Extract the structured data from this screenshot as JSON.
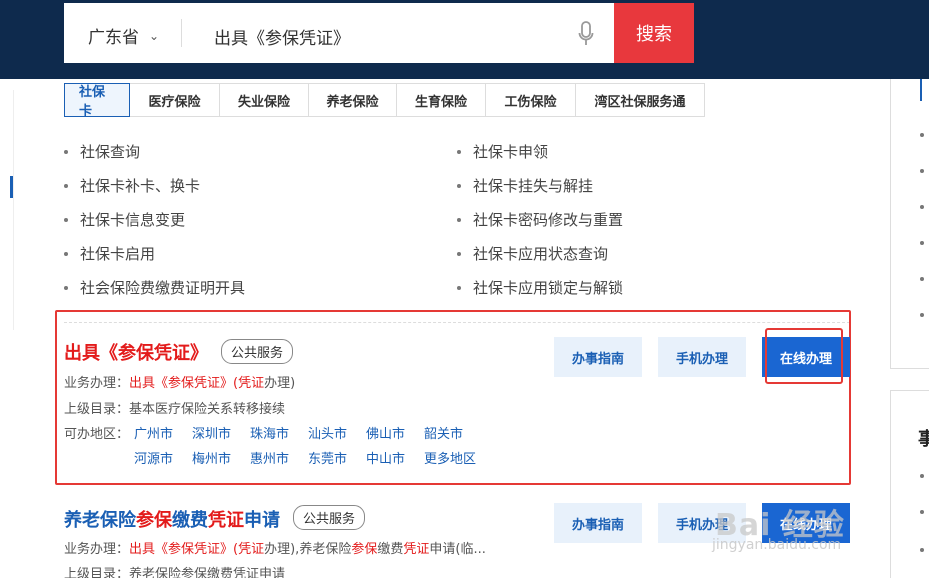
{
  "header": {
    "province": "广东省",
    "search_value": "出具《参保凭证》",
    "search_button": "搜索"
  },
  "tabs": [
    {
      "label": "社保卡",
      "active": true
    },
    {
      "label": "医疗保险"
    },
    {
      "label": "失业保险"
    },
    {
      "label": "养老保险"
    },
    {
      "label": "生育保险"
    },
    {
      "label": "工伤保险"
    },
    {
      "label": "湾区社保服务通"
    }
  ],
  "services": {
    "left": [
      "社保查询",
      "社保卡补卡、换卡",
      "社保卡信息变更",
      "社保卡启用",
      "社会保险费缴费证明开具"
    ],
    "right": [
      "社保卡申领",
      "社保卡挂失与解挂",
      "社保卡密码修改与重置",
      "社保卡应用状态查询",
      "社保卡应用锁定与解锁"
    ]
  },
  "results": [
    {
      "title_part1": "出具",
      "title_part2": "《参保凭证》",
      "tag": "公共服务",
      "business_label": "业务办理：",
      "business_part1": "出具《参保凭证》(",
      "business_part2": "凭证",
      "business_part3": "办理)",
      "catalog": "上级目录：基本医疗保险关系转移接续",
      "region_label": "可办地区：",
      "regions": [
        "广州市",
        "深圳市",
        "珠海市",
        "汕头市",
        "佛山市",
        "韶关市",
        "河源市",
        "梅州市",
        "惠州市",
        "东莞市",
        "中山市",
        "更多地区"
      ],
      "btn_guide": "办事指南",
      "btn_mobile": "手机办理",
      "btn_online": "在线办理"
    },
    {
      "title_a": "养老保险",
      "title_b": "参保",
      "title_c": "缴费",
      "title_d": "凭证",
      "title_e": "申请",
      "tag": "公共服务",
      "business_label": "业务办理：",
      "business_a": "出具《参保凭证》(",
      "business_b": "凭证",
      "business_c": "办理),养老保险",
      "business_d": "参保",
      "business_e": "缴费",
      "business_f": "凭证",
      "business_g": "申请(临...",
      "catalog": "上级目录：养老保险参保缴费凭证申请",
      "btn_guide": "办事指南",
      "btn_mobile": "手机办理",
      "btn_online": "在线办理"
    }
  ],
  "sidebar": {
    "heading_initial": "事"
  },
  "watermark": {
    "text": "Bai 经验",
    "url": "jingyan.baidu.com"
  },
  "colors": {
    "header_bg": "#0e2a4d",
    "search_button": "#e8383d",
    "link_blue": "#1a5fb4",
    "highlight_red": "#e31b1b"
  }
}
